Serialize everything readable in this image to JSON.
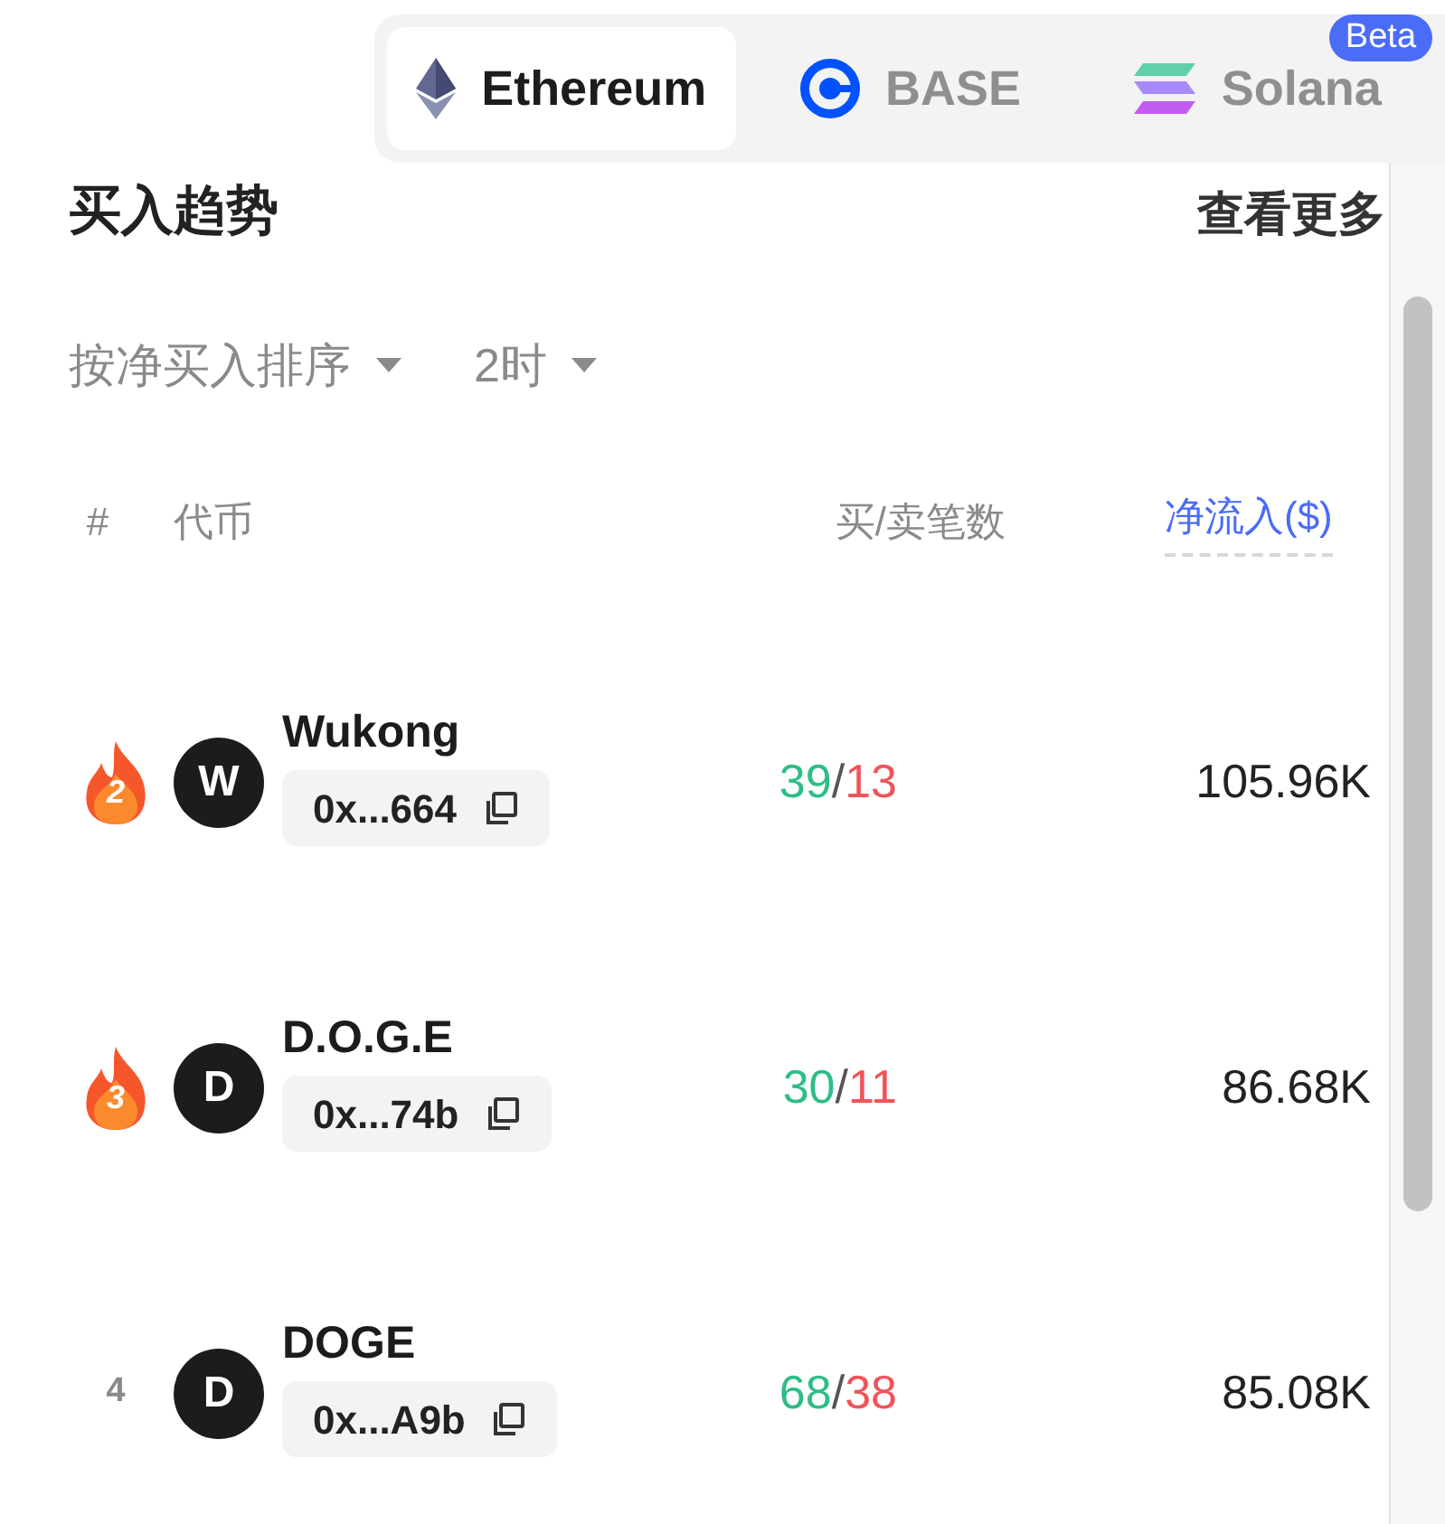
{
  "chains": [
    {
      "label": "Ethereum",
      "kind": "eth",
      "selected": true
    },
    {
      "label": "BASE",
      "kind": "base",
      "selected": false
    },
    {
      "label": "Solana",
      "kind": "sol",
      "selected": false,
      "badge": "Beta"
    }
  ],
  "section": {
    "title": "买入趋势",
    "more": "查看更多"
  },
  "filters": [
    {
      "label": "按净买入排序"
    },
    {
      "label": "2时"
    }
  ],
  "columns": {
    "rank": "#",
    "token": "代币",
    "trades": "买/卖笔数",
    "inflow": "净流入($)"
  },
  "rows": [
    {
      "rank": "2",
      "kind": "flame",
      "avatar": "W",
      "name": "Wukong",
      "address": "0x...664",
      "buys": "39",
      "separator": "/",
      "sells": "13",
      "inflow": "105.96K"
    },
    {
      "rank": "3",
      "kind": "flame",
      "avatar": "D",
      "name": "D.O.G.E",
      "address": "0x...74b",
      "buys": "30",
      "separator": "/",
      "sells": "11",
      "inflow": "86.68K"
    },
    {
      "rank": "4",
      "kind": "plain",
      "avatar": "D",
      "name": "DOGE",
      "address": "0x...A9b",
      "buys": "68",
      "separator": "/",
      "sells": "38",
      "inflow": "85.08K"
    }
  ]
}
